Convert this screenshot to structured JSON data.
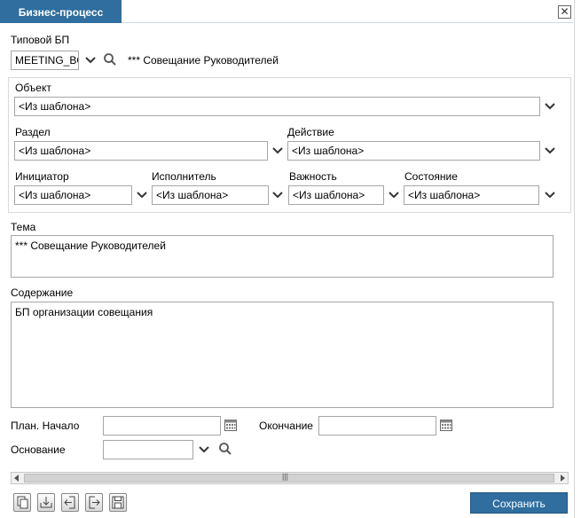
{
  "window": {
    "tab_title": "Бизнес-процесс",
    "close_glyph": "✕"
  },
  "typical_bp": {
    "label": "Типовой БП",
    "value": "MEETING_BO",
    "description": "*** Совещание Руководителей"
  },
  "object_group": {
    "object_label": "Объект",
    "object_value": "<Из шаблона>",
    "section_label": "Раздел",
    "section_value": "<Из шаблона>",
    "action_label": "Действие",
    "action_value": "<Из шаблона>",
    "initiator_label": "Инициатор",
    "initiator_value": "<Из шаблона>",
    "executor_label": "Исполнитель",
    "executor_value": "<Из шаблона>",
    "importance_label": "Важность",
    "importance_value": "<Из шаблона>",
    "state_label": "Состояние",
    "state_value": "<Из шаблона>"
  },
  "topic": {
    "label": "Тема",
    "value": "*** Совещание Руководителей"
  },
  "content": {
    "label": "Содержание",
    "value": "БП организации совещания"
  },
  "plan": {
    "start_label": "План. Начало",
    "start_value": "",
    "end_label": "Окончание",
    "end_value": ""
  },
  "basis": {
    "label": "Основание",
    "value": ""
  },
  "scrollbar": {
    "grip": "|||"
  },
  "footer": {
    "save_label": "Сохранить"
  },
  "icons": [
    "chevron-down-icon",
    "search-icon",
    "calendar-icon",
    "copy-icon",
    "import-icon",
    "exit-icon",
    "enter-icon",
    "save-disk-icon",
    "close-icon"
  ]
}
